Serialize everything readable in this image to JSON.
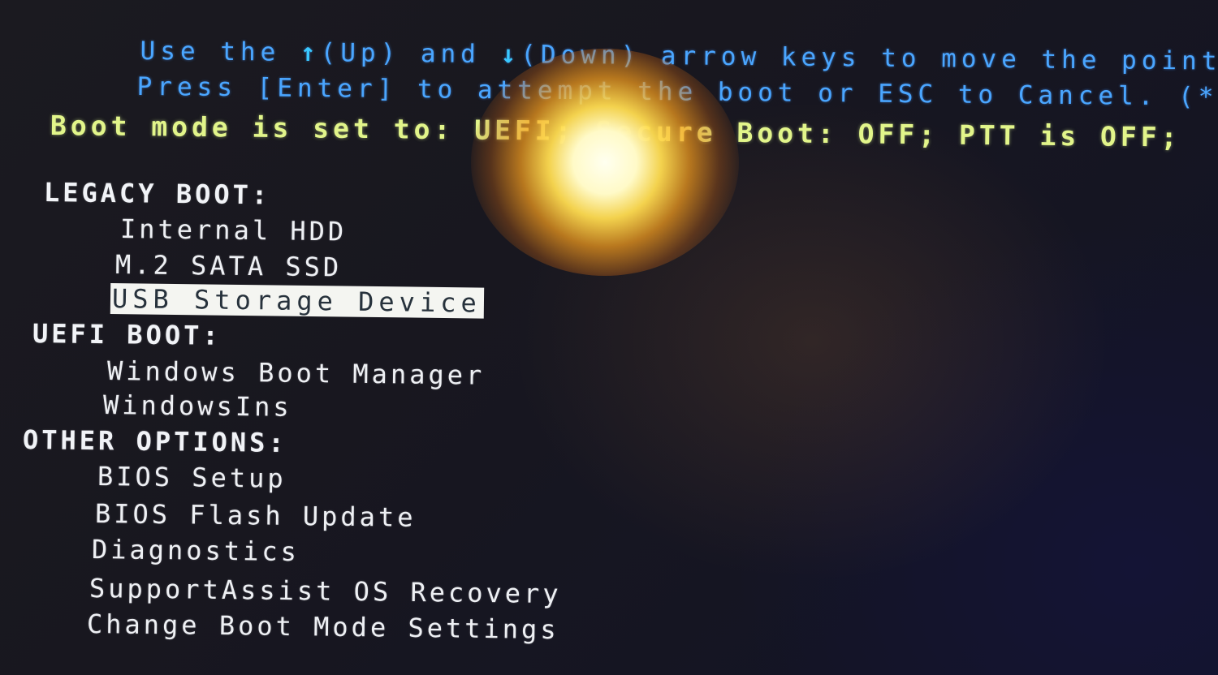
{
  "instructions": {
    "line1_prefix": "Use the ",
    "up_arrow_icon": "↑",
    "line1_up": "(Up) and ",
    "down_arrow_icon": "↓",
    "line1_rest": "(Down) arrow keys to move the pointer to",
    "line2": "Press [Enter] to attempt the boot or ESC to Cancel. (* = Pa"
  },
  "status": {
    "text": "Boot mode is set to: UEFI; Secure Boot: OFF; PTT is OFF;"
  },
  "menu": {
    "sections": [
      {
        "title": "LEGACY BOOT:",
        "items": [
          {
            "label": "Internal HDD",
            "selected": false
          },
          {
            "label": "M.2 SATA SSD",
            "selected": false
          },
          {
            "label": "USB Storage Device",
            "selected": true
          }
        ]
      },
      {
        "title": "UEFI BOOT:",
        "items": [
          {
            "label": "Windows Boot Manager",
            "selected": false
          },
          {
            "label": "WindowsIns",
            "selected": false
          }
        ]
      },
      {
        "title": "OTHER OPTIONS:",
        "items": [
          {
            "label": "BIOS Setup",
            "selected": false
          },
          {
            "label": "BIOS Flash Update",
            "selected": false
          },
          {
            "label": "Diagnostics",
            "selected": false
          },
          {
            "label": "SupportAssist OS Recovery",
            "selected": false
          },
          {
            "label": "Change Boot Mode Settings",
            "selected": false
          }
        ]
      }
    ]
  },
  "colors": {
    "hint_text": "#4aa6ff",
    "status_text": "#e2f58a",
    "menu_text": "#eef0f4",
    "selection_bg": "#f4f5f1",
    "selection_text": "#27323c",
    "background": "#18171f"
  }
}
